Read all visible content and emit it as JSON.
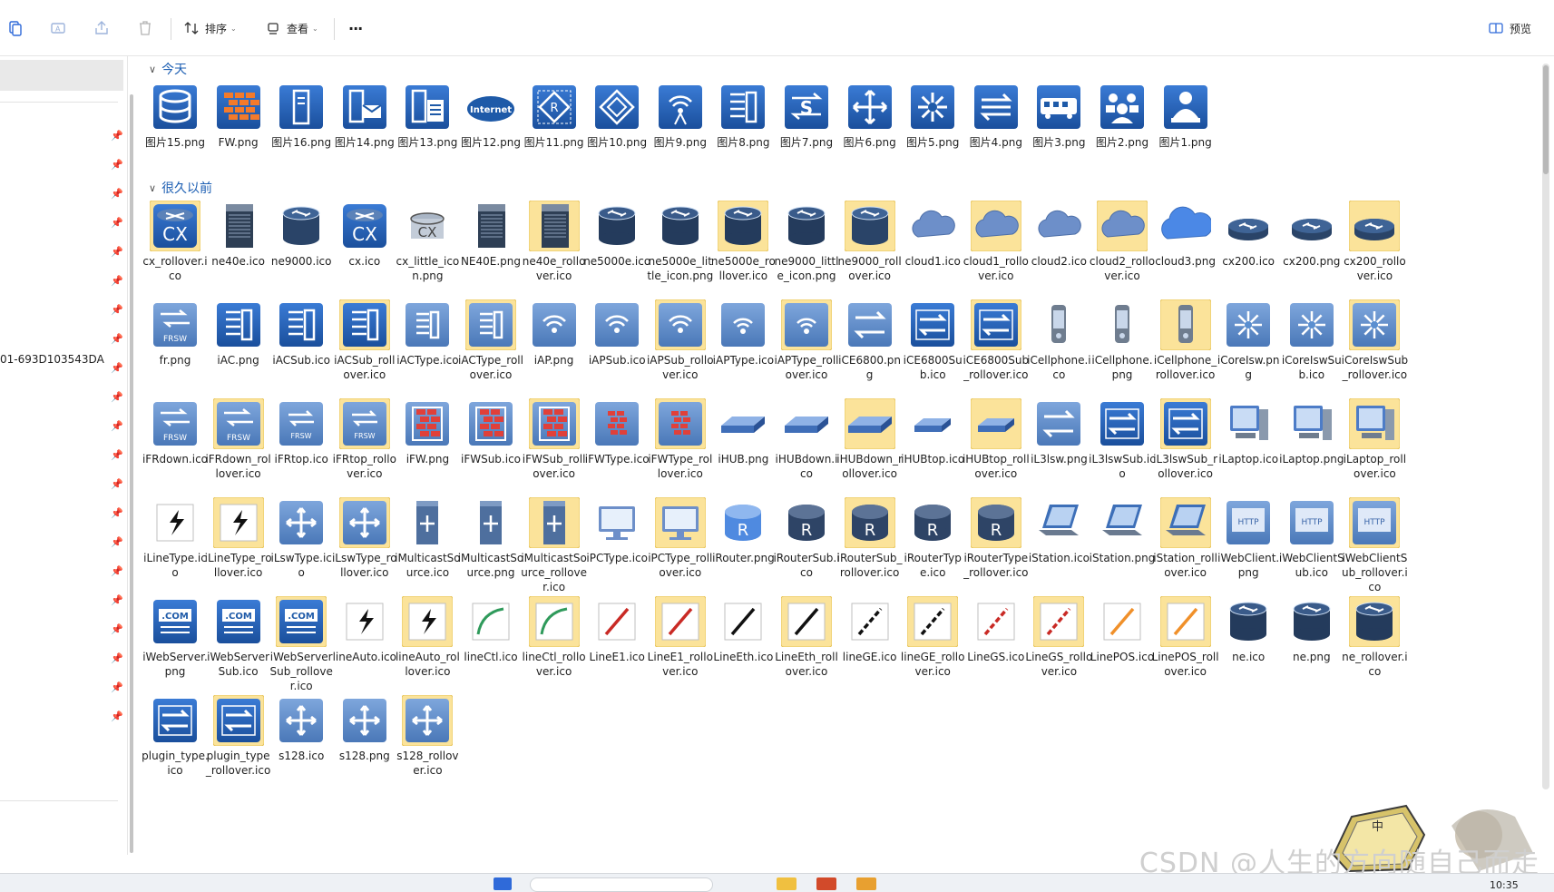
{
  "toolbar": {
    "sort_label": "排序",
    "view_label": "查看",
    "more_label": "···",
    "preview_label": "预览"
  },
  "nav": {
    "partial_label": "01-693D103543DA"
  },
  "groups": [
    {
      "title": "今天",
      "items": [
        {
          "name": "图片15.png",
          "kind": "db"
        },
        {
          "name": "FW.png",
          "kind": "fw"
        },
        {
          "name": "图片16.png",
          "kind": "server"
        },
        {
          "name": "图片14.png",
          "kind": "mail"
        },
        {
          "name": "图片13.png",
          "kind": "doc"
        },
        {
          "name": "图片12.png",
          "kind": "internet"
        },
        {
          "name": "图片11.png",
          "kind": "diamond"
        },
        {
          "name": "图片10.png",
          "kind": "diamond2"
        },
        {
          "name": "图片9.png",
          "kind": "wifi"
        },
        {
          "name": "图片8.png",
          "kind": "ac"
        },
        {
          "name": "图片7.png",
          "kind": "switchS"
        },
        {
          "name": "图片6.png",
          "kind": "arrows4"
        },
        {
          "name": "图片5.png",
          "kind": "core"
        },
        {
          "name": "图片4.png",
          "kind": "swap"
        },
        {
          "name": "图片3.png",
          "kind": "bus"
        },
        {
          "name": "图片2.png",
          "kind": "group"
        },
        {
          "name": "图片1.png",
          "kind": "user"
        }
      ]
    },
    {
      "title": "很久以前",
      "items": [
        {
          "name": "cx_rollover.ico",
          "kind": "cx",
          "hl": true
        },
        {
          "name": "ne40e.ico",
          "kind": "rack"
        },
        {
          "name": "ne9000.ico",
          "kind": "router_dk"
        },
        {
          "name": "cx.ico",
          "kind": "cx"
        },
        {
          "name": "cx_little_icon.png",
          "kind": "cx_small"
        },
        {
          "name": "NE40E.png",
          "kind": "rack"
        },
        {
          "name": "ne40e_rollover.ico",
          "kind": "rack",
          "hl": true
        },
        {
          "name": "ne5000e.ico",
          "kind": "cyl"
        },
        {
          "name": "ne5000e_little_icon.png",
          "kind": "cyl"
        },
        {
          "name": "ne5000e_rollover.ico",
          "kind": "cyl",
          "hl": true
        },
        {
          "name": "ne9000_little_icon.png",
          "kind": "cyl"
        },
        {
          "name": "ne9000_rollover.ico",
          "kind": "router_dk",
          "hl": true
        },
        {
          "name": "cloud1.ico",
          "kind": "cloud"
        },
        {
          "name": "cloud1_rollover.ico",
          "kind": "cloud",
          "hl": true
        },
        {
          "name": "cloud2.ico",
          "kind": "cloud"
        },
        {
          "name": "cloud2_rollover.ico",
          "kind": "cloud",
          "hl": true
        },
        {
          "name": "cloud3.png",
          "kind": "cloud_big"
        },
        {
          "name": "cx200.ico",
          "kind": "router_flat"
        },
        {
          "name": "cx200.png",
          "kind": "router_flat"
        },
        {
          "name": "cx200_rollover.ico",
          "kind": "router_flat",
          "hl": true
        },
        {
          "name": "fr.png",
          "kind": "frsw"
        },
        {
          "name": "iAC.png",
          "kind": "ac"
        },
        {
          "name": "iACSub.ico",
          "kind": "ac"
        },
        {
          "name": "iACSub_rollover.ico",
          "kind": "ac",
          "hl": true
        },
        {
          "name": "iACType.ico",
          "kind": "ac_s"
        },
        {
          "name": "iACType_rollover.ico",
          "kind": "ac_s",
          "hl": true
        },
        {
          "name": "iAP.png",
          "kind": "ap"
        },
        {
          "name": "iAPSub.ico",
          "kind": "ap"
        },
        {
          "name": "iAPSub_rollover.ico",
          "kind": "ap",
          "hl": true
        },
        {
          "name": "iAPType.ico",
          "kind": "ap_s"
        },
        {
          "name": "iAPType_rollover.ico",
          "kind": "ap_s",
          "hl": true
        },
        {
          "name": "iCE6800.png",
          "kind": "swap_lt"
        },
        {
          "name": "iCE6800Sub.ico",
          "kind": "swap_box"
        },
        {
          "name": "iCE6800Sub_rollover.ico",
          "kind": "swap_box",
          "hl": true
        },
        {
          "name": "iCellphone.ico",
          "kind": "phone"
        },
        {
          "name": "iCellphone.png",
          "kind": "phone"
        },
        {
          "name": "iCellphone_rollover.ico",
          "kind": "phone",
          "hl": true
        },
        {
          "name": "iCoreIsw.png",
          "kind": "core_lt"
        },
        {
          "name": "iCoreIswSub.ico",
          "kind": "core_lt"
        },
        {
          "name": "iCoreIswSub_rollover.ico",
          "kind": "core_lt",
          "hl": true
        },
        {
          "name": "iFRdown.ico",
          "kind": "frsw"
        },
        {
          "name": "iFRdown_rollover.ico",
          "kind": "frsw",
          "hl": true
        },
        {
          "name": "iFRtop.ico",
          "kind": "frsw_s"
        },
        {
          "name": "iFRtop_rollover.ico",
          "kind": "frsw_s",
          "hl": true
        },
        {
          "name": "iFW.png",
          "kind": "fw_lt"
        },
        {
          "name": "iFWSub.ico",
          "kind": "fw_lt"
        },
        {
          "name": "iFWSub_rollover.ico",
          "kind": "fw_lt",
          "hl": true
        },
        {
          "name": "iFWType.ico",
          "kind": "fw_s"
        },
        {
          "name": "iFWType_rollover.ico",
          "kind": "fw_s",
          "hl": true
        },
        {
          "name": "iHUB.png",
          "kind": "hub"
        },
        {
          "name": "iHUBdown.ico",
          "kind": "hub"
        },
        {
          "name": "iHUBdown_rollover.ico",
          "kind": "hub",
          "hl": true
        },
        {
          "name": "iHUBtop.ico",
          "kind": "hub_s"
        },
        {
          "name": "iHUBtop_rollover.ico",
          "kind": "hub_s",
          "hl": true
        },
        {
          "name": "iL3lsw.png",
          "kind": "swap_lt"
        },
        {
          "name": "iL3lswSub.ico",
          "kind": "swap_box"
        },
        {
          "name": "iL3lswSub_rollover.ico",
          "kind": "swap_box",
          "hl": true
        },
        {
          "name": "iLaptop.ico",
          "kind": "pc"
        },
        {
          "name": "iLaptop.png",
          "kind": "pc"
        },
        {
          "name": "iLaptop_rollover.ico",
          "kind": "pc",
          "hl": true
        },
        {
          "name": "iLineType.ico",
          "kind": "bolt"
        },
        {
          "name": "iLineType_rollover.ico",
          "kind": "bolt",
          "hl": true
        },
        {
          "name": "iLswType.ico",
          "kind": "arrows_box"
        },
        {
          "name": "iLswType_rollover.ico",
          "kind": "arrows_box",
          "hl": true
        },
        {
          "name": "iMulticastSource.ico",
          "kind": "tower"
        },
        {
          "name": "iMulticastSource.png",
          "kind": "tower"
        },
        {
          "name": "iMulticastSource_rollover.ico",
          "kind": "tower",
          "hl": true
        },
        {
          "name": "iPCType.ico",
          "kind": "monitor"
        },
        {
          "name": "iPCType_rollover.ico",
          "kind": "monitor",
          "hl": true
        },
        {
          "name": "iRouter.png",
          "kind": "router_R"
        },
        {
          "name": "iRouterSub.ico",
          "kind": "router_R_dk"
        },
        {
          "name": "iRouterSub_rollover.ico",
          "kind": "router_R_dk",
          "hl": true
        },
        {
          "name": "iRouterType.ico",
          "kind": "router_R_dk"
        },
        {
          "name": "iRouterType_rollover.ico",
          "kind": "router_R_dk",
          "hl": true
        },
        {
          "name": "iStation.ico",
          "kind": "laptop"
        },
        {
          "name": "iStation.png",
          "kind": "laptop"
        },
        {
          "name": "iStation_rollover.ico",
          "kind": "laptop",
          "hl": true
        },
        {
          "name": "iWebClient.png",
          "kind": "http"
        },
        {
          "name": "iWebClientSub.ico",
          "kind": "http"
        },
        {
          "name": "iWebClientSub_rollover.ico",
          "kind": "http",
          "hl": true
        },
        {
          "name": "iWebServer.png",
          "kind": "com"
        },
        {
          "name": "iWebServerSub.ico",
          "kind": "com"
        },
        {
          "name": "iWebServerSub_rollover.ico",
          "kind": "com",
          "hl": true
        },
        {
          "name": "lineAuto.ico",
          "kind": "bolt"
        },
        {
          "name": "lineAuto_rollover.ico",
          "kind": "bolt",
          "hl": true
        },
        {
          "name": "lineCtl.ico",
          "kind": "line_green"
        },
        {
          "name": "lineCtl_rollover.ico",
          "kind": "line_green",
          "hl": true
        },
        {
          "name": "LineE1.ico",
          "kind": "line_red"
        },
        {
          "name": "LineE1_rollover.ico",
          "kind": "line_red",
          "hl": true
        },
        {
          "name": "LineEth.ico",
          "kind": "line_black"
        },
        {
          "name": "LineEth_rollover.ico",
          "kind": "line_black",
          "hl": true
        },
        {
          "name": "lineGE.ico",
          "kind": "line_dash"
        },
        {
          "name": "lineGE_rollover.ico",
          "kind": "line_dash",
          "hl": true
        },
        {
          "name": "LineGS.ico",
          "kind": "line_reddash"
        },
        {
          "name": "LineGS_rollover.ico",
          "kind": "line_reddash",
          "hl": true
        },
        {
          "name": "LinePOS.ico",
          "kind": "line_orange"
        },
        {
          "name": "LinePOS_rollover.ico",
          "kind": "line_orange",
          "hl": true
        },
        {
          "name": "ne.ico",
          "kind": "cyl"
        },
        {
          "name": "ne.png",
          "kind": "cyl"
        },
        {
          "name": "ne_rollover.ico",
          "kind": "cyl",
          "hl": true
        },
        {
          "name": "plugin_type.ico",
          "kind": "swap_box"
        },
        {
          "name": "plugin_type_rollover.ico",
          "kind": "swap_box",
          "hl": true
        },
        {
          "name": "s128.ico",
          "kind": "arrows_box"
        },
        {
          "name": "s128.png",
          "kind": "arrows_box"
        },
        {
          "name": "s128_rollover.ico",
          "kind": "arrows_box",
          "hl": true
        }
      ]
    }
  ],
  "watermark": "CSDN @人生的方向随自己而走",
  "mascot_badge": "中",
  "clock": "10:35",
  "colors": {
    "accent": "#1d5fb3",
    "icon_blue": "#1e5aa8",
    "rollover_bg": "#fbe39a"
  }
}
